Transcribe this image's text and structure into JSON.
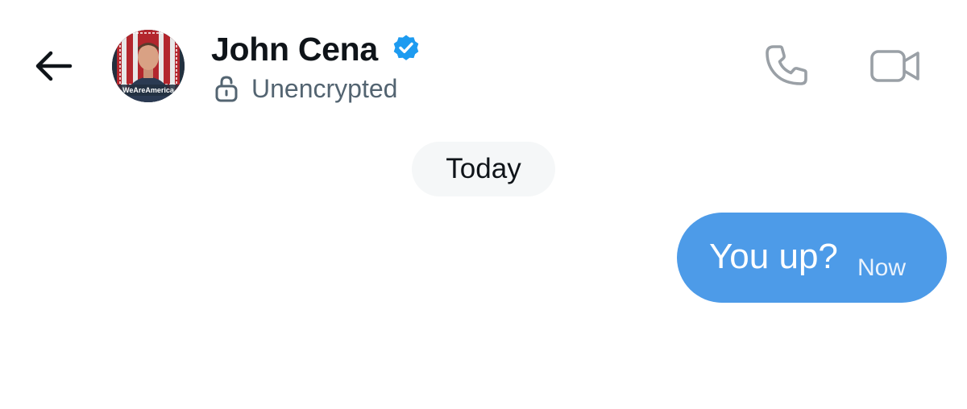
{
  "header": {
    "contact_name": "John Cena",
    "verified": true,
    "encryption_status": "Unencrypted",
    "avatar_caption": "WeAreAmerica",
    "icons": {
      "back": "arrow-left-icon",
      "verified": "verified-badge-icon",
      "encryption": "unlocked-padlock-icon",
      "call": "phone-icon",
      "video": "video-camera-icon"
    }
  },
  "conversation": {
    "date_separator": "Today",
    "messages": [
      {
        "sender": "me",
        "text": "You up?",
        "time": "Now"
      }
    ]
  },
  "colors": {
    "sent_bubble": "#4d9be8",
    "verified_badge": "#1d9bf0",
    "muted_text": "#536471",
    "icon_gray": "#9aa0a6",
    "date_pill": "#f5f7f8"
  }
}
